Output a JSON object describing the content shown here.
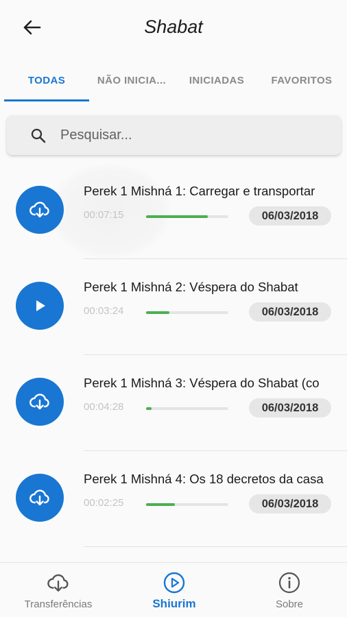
{
  "header": {
    "title": "Shabat",
    "back_icon": "arrow-left-icon"
  },
  "tabs": [
    {
      "label": "TODAS",
      "active": true
    },
    {
      "label": "NÃO INICIA...",
      "active": false
    },
    {
      "label": "INICIADAS",
      "active": false
    },
    {
      "label": "FAVORITOS",
      "active": false
    }
  ],
  "search": {
    "placeholder": "Pesquisar...",
    "value": "",
    "icon": "search-icon"
  },
  "items": [
    {
      "title": "Perek 1 Mishná 1: Carregar e transportar",
      "duration": "00:07:15",
      "progress": 0.75,
      "date": "06/03/2018",
      "icon": "cloud-download-icon"
    },
    {
      "title": "Perek 1 Mishná 2: Véspera do Shabat",
      "duration": "00:03:24",
      "progress": 0.28,
      "date": "06/03/2018",
      "icon": "play-icon"
    },
    {
      "title": "Perek 1 Mishná 3: Véspera do Shabat (co",
      "duration": "00:04:28",
      "progress": 0.07,
      "date": "06/03/2018",
      "icon": "cloud-download-icon"
    },
    {
      "title": "Perek 1 Mishná 4: Os 18 decretos da casa",
      "duration": "00:02:25",
      "progress": 0.35,
      "date": "06/03/2018",
      "icon": "cloud-download-icon"
    }
  ],
  "bottom_nav": [
    {
      "label": "Transferências",
      "icon": "cloud-download-icon",
      "active": false
    },
    {
      "label": "Shiurim",
      "icon": "play-circle-icon",
      "active": true
    },
    {
      "label": "Sobre",
      "icon": "info-icon",
      "active": false
    }
  ],
  "colors": {
    "accent": "#1976d2",
    "progress": "#4caf50",
    "background": "#fafafa"
  }
}
